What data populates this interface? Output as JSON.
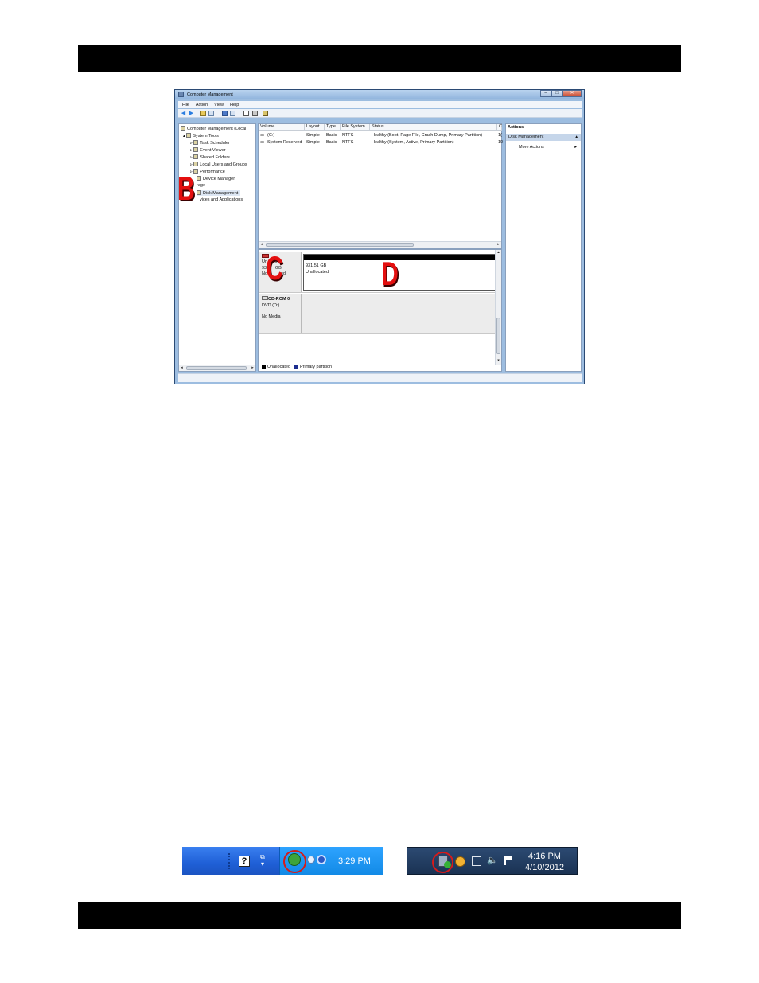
{
  "window": {
    "title": "Computer Management",
    "menus": [
      "File",
      "Action",
      "View",
      "Help"
    ]
  },
  "tree": {
    "root": "Computer Management (Local",
    "system_tools": "System Tools",
    "items": [
      "Task Scheduler",
      "Event Viewer",
      "Shared Folders",
      "Local Users and Groups",
      "Performance",
      "Device Manager"
    ],
    "storage": "rage",
    "disk_management": "Disk Management",
    "services": "vices and Applications"
  },
  "volume_list": {
    "columns": [
      "Volume",
      "Layout",
      "Type",
      "File System",
      "Status",
      "C"
    ],
    "rows": [
      [
        "(C:)",
        "Simple",
        "Basic",
        "NTFS",
        "Healthy (Boot, Page File, Crash Dump, Primary Partition)",
        "1("
      ],
      [
        "System Reserved",
        "Simple",
        "Basic",
        "NTFS",
        "Healthy (System, Active, Primary Partition)",
        "10"
      ]
    ]
  },
  "disks": {
    "disk1": {
      "label_top": "Un",
      "label_top2": "own",
      "size_left": "93",
      "size_right": "GB",
      "status_left": "No",
      "status_right": "ed",
      "partition_size": "931.51 GB",
      "partition_status": "Unallocated"
    },
    "cdrom": {
      "name": "CD-ROM 0",
      "drive": "DVD (D:)",
      "media": "No Media"
    },
    "legend": [
      "Unallocated",
      "Primary partition"
    ],
    "colors": {
      "unallocated": "#000000",
      "primary": "#1c2d8f"
    }
  },
  "actions": {
    "header": "Actions",
    "selected": "Disk Management",
    "more": "More Actions"
  },
  "callouts": {
    "b": "B",
    "c": "C",
    "d": "D"
  },
  "taskbar_xp": {
    "time": "3:29 PM"
  },
  "taskbar_win7": {
    "time": "4:16 PM",
    "date": "4/10/2012"
  },
  "accent": {
    "callout_red": "#e40f0f"
  }
}
